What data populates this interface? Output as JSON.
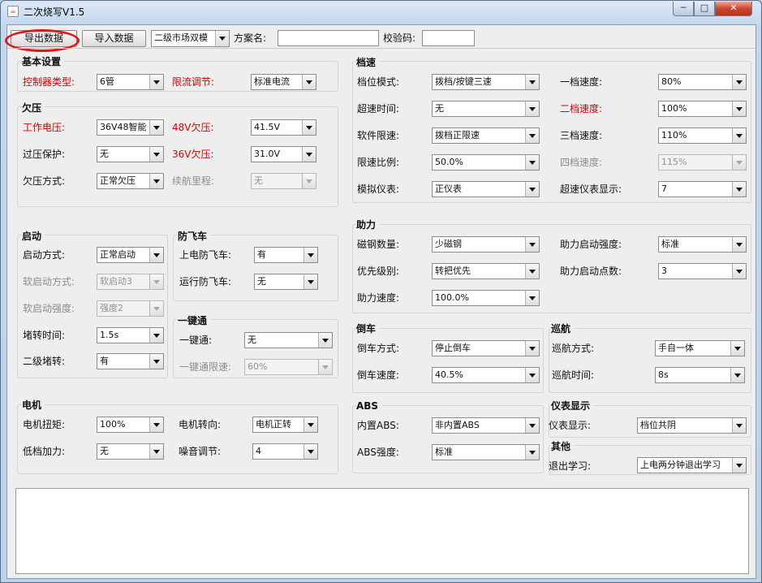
{
  "window": {
    "title": "二次烧写V1.5",
    "min_glyph": "─",
    "max_glyph": "□",
    "close_glyph": "✕"
  },
  "toolbar": {
    "export_label": "导出数据",
    "import_label": "导入数据",
    "mode_value": "二级市场双模",
    "scheme_label": "方案名:",
    "scheme_value": "",
    "checksum_label": "校验码:",
    "checksum_value": ""
  },
  "basic": {
    "title": "基本设置",
    "controller_label": "控制器类型:",
    "controller_value": "6管",
    "limit_label": "限流调节:",
    "limit_value": "标准电流"
  },
  "undervoltage": {
    "title": "欠压",
    "work_voltage_label": "工作电压:",
    "work_voltage_value": "36V48智能",
    "uv48_label": "48V欠压:",
    "uv48_value": "41.5V",
    "overvoltage_label": "过压保护:",
    "overvoltage_value": "无",
    "uv36_label": "36V欠压:",
    "uv36_value": "31.0V",
    "uv_mode_label": "欠压方式:",
    "uv_mode_value": "正常欠压",
    "range_label": "续航里程:",
    "range_value": "无"
  },
  "start": {
    "title": "启动",
    "mode_label": "启动方式:",
    "mode_value": "正常启动",
    "soft_mode_label": "软启动方式:",
    "soft_mode_value": "软启动3",
    "soft_strength_label": "软启动强度:",
    "soft_strength_value": "强度2",
    "stall_time_label": "堵转时间:",
    "stall_time_value": "1.5s",
    "stall2_label": "二级堵转:",
    "stall2_value": "有"
  },
  "antirun": {
    "title": "防飞车",
    "poweron_label": "上电防飞车:",
    "poweron_value": "有",
    "running_label": "运行防飞车:",
    "running_value": "无"
  },
  "onekey": {
    "title": "一键通",
    "onekey_label": "一键通:",
    "onekey_value": "无",
    "limit_label": "一键通限速:",
    "limit_value": "60%"
  },
  "motor": {
    "title": "电机",
    "torque_label": "电机扭矩:",
    "torque_value": "100%",
    "direction_label": "电机转向:",
    "direction_value": "电机正转",
    "lowgear_label": "低档加力:",
    "lowgear_value": "无",
    "noise_label": "噪音调节:",
    "noise_value": "4"
  },
  "gear": {
    "title": "档速",
    "mode_label": "档位模式:",
    "mode_value": "拨档/按键三速",
    "g1_label": "一档速度:",
    "g1_value": "80%",
    "overspeed_label": "超速时间:",
    "overspeed_value": "无",
    "g2_label": "二档速度:",
    "g2_value": "100%",
    "soft_limit_label": "软件限速:",
    "soft_limit_value": "拨档正限速",
    "g3_label": "三档速度:",
    "g3_value": "110%",
    "ratio_label": "限速比例:",
    "ratio_value": "50.0%",
    "g4_label": "四档速度:",
    "g4_value": "115%",
    "meter_label": "模拟仪表:",
    "meter_value": "正仪表",
    "over_meter_label": "超速仪表显示:",
    "over_meter_value": "7"
  },
  "assist": {
    "title": "助力",
    "magnet_label": "磁钢数量:",
    "magnet_value": "少磁钢",
    "start_strength_label": "助力启动强度:",
    "start_strength_value": "标准",
    "priority_label": "优先级别:",
    "priority_value": "转把优先",
    "start_points_label": "助力启动点数:",
    "start_points_value": "3",
    "speed_label": "助力速度:",
    "speed_value": "100.0%"
  },
  "reverse": {
    "title": "倒车",
    "mode_label": "倒车方式:",
    "mode_value": "停止倒车",
    "speed_label": "倒车速度:",
    "speed_value": "40.5%"
  },
  "cruise": {
    "title": "巡航",
    "mode_label": "巡航方式:",
    "mode_value": "手自一体",
    "time_label": "巡航时间:",
    "time_value": "8s"
  },
  "abs": {
    "title": "ABS",
    "builtin_label": "内置ABS:",
    "builtin_value": "非内置ABS",
    "strength_label": "ABS强度:",
    "strength_value": "标准"
  },
  "display": {
    "title": "仪表显示",
    "display_label": "仪表显示:",
    "display_value": "档位共阴"
  },
  "other": {
    "title": "其他",
    "exit_label": "退出学习:",
    "exit_value": "上电两分钟退出学习"
  },
  "colors": {
    "red_label": "#d40000",
    "annotation": "#e01818"
  }
}
